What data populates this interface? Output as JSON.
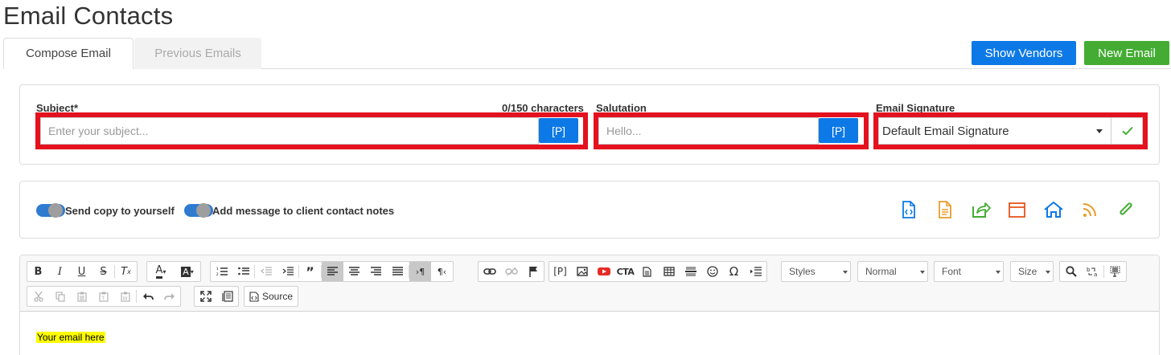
{
  "page": {
    "title": "Email Contacts"
  },
  "tabs": [
    {
      "label": "Compose Email",
      "active": true
    },
    {
      "label": "Previous Emails",
      "active": false
    }
  ],
  "header_buttons": {
    "show_vendors": "Show Vendors",
    "new_email": "New Email"
  },
  "colors": {
    "primary": "#0d79e6",
    "success": "#44ac33",
    "highlight_border": "#e3121e",
    "toggle_on": "#2f7bd0"
  },
  "form": {
    "subject": {
      "label": "Subject*",
      "char_count": "0/150 characters",
      "placeholder": "Enter your subject...",
      "value": "",
      "token_button": "[P]"
    },
    "salutation": {
      "label": "Salutation",
      "placeholder": "Hello...",
      "value": "",
      "token_button": "[P]"
    },
    "signature": {
      "label": "Email Signature",
      "selected": "Default Email Signature"
    }
  },
  "options": {
    "send_copy": {
      "label": "Send copy to yourself",
      "on": true
    },
    "add_to_notes": {
      "label": "Add message to client contact notes",
      "on": true
    }
  },
  "actions": [
    {
      "icon": "code-file-icon",
      "color": "#0d79e6"
    },
    {
      "icon": "document-icon",
      "color": "#e89c2b"
    },
    {
      "icon": "share-icon",
      "color": "#44ac33"
    },
    {
      "icon": "browser-window-icon",
      "color": "#e8531c"
    },
    {
      "icon": "home-icon",
      "color": "#0d79e6"
    },
    {
      "icon": "rss-icon",
      "color": "#e89c2b"
    },
    {
      "icon": "paperclip-icon",
      "color": "#44ac33"
    }
  ],
  "editor": {
    "combos": {
      "styles": "Styles",
      "format": "Normal",
      "font": "Font",
      "size": "Size"
    },
    "source_label": "Source",
    "cta_label": "CTA",
    "token_label": "[P]",
    "content": "Your email here"
  }
}
